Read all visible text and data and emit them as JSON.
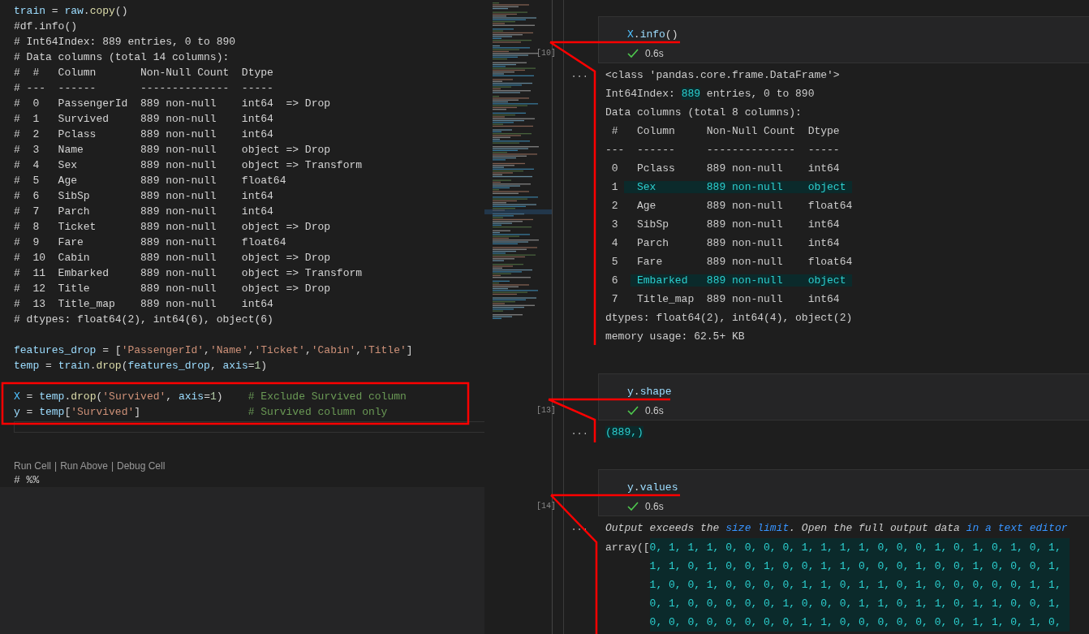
{
  "editor": {
    "lines": [
      {
        "kind": "code",
        "tokens": [
          {
            "kind": "variable",
            "text": "train"
          },
          {
            "kind": "plain",
            "text": " = "
          },
          {
            "kind": "variable",
            "text": "raw"
          },
          {
            "kind": "plain",
            "text": "."
          },
          {
            "kind": "function",
            "text": "copy"
          },
          {
            "kind": "plain",
            "text": "()"
          }
        ]
      },
      {
        "kind": "comment",
        "text": "#df.info()"
      },
      {
        "kind": "comment",
        "text": "# Int64Index: 889 entries, 0 to 890"
      },
      {
        "kind": "comment",
        "text": "# Data columns (total 14 columns):"
      },
      {
        "kind": "comment",
        "text": "#  #   Column       Non-Null Count  Dtype"
      },
      {
        "kind": "comment",
        "text": "# ---  ------       --------------  -----"
      },
      {
        "kind": "comment",
        "text": "#  0   PassengerId  889 non-null    int64  => Drop"
      },
      {
        "kind": "comment",
        "text": "#  1   Survived     889 non-null    int64"
      },
      {
        "kind": "comment",
        "text": "#  2   Pclass       889 non-null    int64"
      },
      {
        "kind": "comment",
        "text": "#  3   Name         889 non-null    object => Drop"
      },
      {
        "kind": "comment",
        "text": "#  4   Sex          889 non-null    object => Transform"
      },
      {
        "kind": "comment",
        "text": "#  5   Age          889 non-null    float64"
      },
      {
        "kind": "comment",
        "text": "#  6   SibSp        889 non-null    int64"
      },
      {
        "kind": "comment",
        "text": "#  7   Parch        889 non-null    int64"
      },
      {
        "kind": "comment",
        "text": "#  8   Ticket       889 non-null    object => Drop"
      },
      {
        "kind": "comment",
        "text": "#  9   Fare         889 non-null    float64"
      },
      {
        "kind": "comment",
        "text": "#  10  Cabin        889 non-null    object => Drop"
      },
      {
        "kind": "comment",
        "text": "#  11  Embarked     889 non-null    object => Transform"
      },
      {
        "kind": "comment",
        "text": "#  12  Title        889 non-null    object => Drop"
      },
      {
        "kind": "comment",
        "text": "#  13  Title_map    889 non-null    int64"
      },
      {
        "kind": "comment",
        "text": "# dtypes: float64(2), int64(6), object(6)"
      },
      {
        "kind": "blank"
      },
      {
        "kind": "code",
        "tokens": [
          {
            "kind": "variable",
            "text": "features_drop"
          },
          {
            "kind": "plain",
            "text": " = ["
          },
          {
            "kind": "string",
            "text": "'PassengerId'"
          },
          {
            "kind": "plain",
            "text": ","
          },
          {
            "kind": "string",
            "text": "'Name'"
          },
          {
            "kind": "plain",
            "text": ","
          },
          {
            "kind": "string",
            "text": "'Ticket'"
          },
          {
            "kind": "plain",
            "text": ","
          },
          {
            "kind": "string",
            "text": "'Cabin'"
          },
          {
            "kind": "plain",
            "text": ","
          },
          {
            "kind": "string",
            "text": "'Title'"
          },
          {
            "kind": "plain",
            "text": "]"
          }
        ]
      },
      {
        "kind": "code",
        "tokens": [
          {
            "kind": "variable",
            "text": "temp"
          },
          {
            "kind": "plain",
            "text": " = "
          },
          {
            "kind": "variable",
            "text": "train"
          },
          {
            "kind": "plain",
            "text": "."
          },
          {
            "kind": "function",
            "text": "drop"
          },
          {
            "kind": "plain",
            "text": "("
          },
          {
            "kind": "variable",
            "text": "features_drop"
          },
          {
            "kind": "plain",
            "text": ", "
          },
          {
            "kind": "variable",
            "text": "axis"
          },
          {
            "kind": "plain",
            "text": "="
          },
          {
            "kind": "number",
            "text": "1"
          },
          {
            "kind": "plain",
            "text": ")"
          }
        ]
      },
      {
        "kind": "blank"
      },
      {
        "kind": "code",
        "tokens": [
          {
            "kind": "constant",
            "text": "X"
          },
          {
            "kind": "plain",
            "text": " = "
          },
          {
            "kind": "variable",
            "text": "temp"
          },
          {
            "kind": "plain",
            "text": "."
          },
          {
            "kind": "function",
            "text": "drop"
          },
          {
            "kind": "plain",
            "text": "("
          },
          {
            "kind": "string",
            "text": "'Survived'"
          },
          {
            "kind": "plain",
            "text": ", "
          },
          {
            "kind": "variable",
            "text": "axis"
          },
          {
            "kind": "plain",
            "text": "="
          },
          {
            "kind": "number",
            "text": "1"
          },
          {
            "kind": "plain",
            "text": ")    "
          },
          {
            "kind": "comment",
            "text": "# Exclude Survived column"
          }
        ]
      },
      {
        "kind": "code",
        "tokens": [
          {
            "kind": "variable",
            "text": "y"
          },
          {
            "kind": "plain",
            "text": " = "
          },
          {
            "kind": "variable",
            "text": "temp"
          },
          {
            "kind": "plain",
            "text": "["
          },
          {
            "kind": "string",
            "text": "'Survived'"
          },
          {
            "kind": "plain",
            "text": "]                 "
          },
          {
            "kind": "comment",
            "text": "# Survived column only"
          }
        ]
      }
    ],
    "codelens": {
      "items": [
        "Run Cell",
        "Run Above",
        "Debug Cell"
      ],
      "separator": "|"
    },
    "next_cell_marker": "# %%"
  },
  "notebook": {
    "cells": [
      {
        "number": "[10]",
        "source": [
          {
            "kind": "constant",
            "text": "X"
          },
          {
            "kind": "plain",
            "text": "."
          },
          {
            "kind": "variable",
            "text": "info"
          },
          {
            "kind": "plain",
            "text": "()"
          }
        ],
        "succeeded": true,
        "duration": "0.6s",
        "output_marker": "...",
        "output": {
          "kind": "text",
          "lines": [
            [
              {
                "text": "<class 'pandas.core.frame.DataFrame'>",
                "highlighted": false
              }
            ],
            [
              {
                "text": "Int64Index: ",
                "highlighted": false
              },
              {
                "text": "889",
                "highlighted": true
              },
              {
                "text": " entries, 0 to 890",
                "highlighted": false
              }
            ],
            [
              {
                "text": "Data columns (total 8 columns):",
                "highlighted": false
              }
            ],
            [
              {
                "text": " #   Column     Non-Null Count  Dtype",
                "highlighted": false
              }
            ],
            [
              {
                "text": "---  ------     --------------  -----",
                "highlighted": false
              }
            ],
            [
              {
                "text": " 0   Pclass     889 non-null    int64",
                "highlighted": false
              }
            ],
            [
              {
                "text": " 1 ",
                "highlighted": false
              },
              {
                "text": "  Sex        889 non-null    object ",
                "highlighted": true
              }
            ],
            [
              {
                "text": " 2   Age        889 non-null    float64",
                "highlighted": false
              }
            ],
            [
              {
                "text": " 3   SibSp      889 non-null    int64",
                "highlighted": false
              }
            ],
            [
              {
                "text": " 4   Parch      889 non-null    int64",
                "highlighted": false
              }
            ],
            [
              {
                "text": " 5   Fare       889 non-null    float64",
                "highlighted": false
              }
            ],
            [
              {
                "text": " 6  ",
                "highlighted": false
              },
              {
                "text": " Embarked   889 non-null    object ",
                "highlighted": true
              }
            ],
            [
              {
                "text": " 7   Title_map  889 non-null    int64",
                "highlighted": false
              }
            ],
            [
              {
                "text": "dtypes: float64(2), int64(4), object(2)",
                "highlighted": false
              }
            ],
            [
              {
                "text": "memory usage: 62.5+ KB",
                "highlighted": false
              }
            ]
          ]
        }
      },
      {
        "number": "[13]",
        "source": [
          {
            "kind": "variable",
            "text": "y"
          },
          {
            "kind": "plain",
            "text": "."
          },
          {
            "kind": "variable",
            "text": "shape"
          }
        ],
        "succeeded": true,
        "duration": "0.6s",
        "output_marker": "...",
        "output": {
          "kind": "text",
          "lines": [
            [
              {
                "text": "(889,)",
                "highlighted": true
              }
            ]
          ]
        }
      },
      {
        "number": "[14]",
        "source": [
          {
            "kind": "variable",
            "text": "y"
          },
          {
            "kind": "plain",
            "text": "."
          },
          {
            "kind": "variable",
            "text": "values"
          }
        ],
        "succeeded": true,
        "duration": "0.6s",
        "output_marker": "...",
        "output": {
          "kind": "array",
          "notice": [
            {
              "text": "Output exceeds the ",
              "link": false
            },
            {
              "text": "size limit",
              "link": true
            },
            {
              "text": ". Open the full output data ",
              "link": false
            },
            {
              "text": "in a text editor",
              "link": true
            }
          ],
          "prefix": "array([",
          "rows": [
            "0, 1, 1, 1, 0, 0, 0, 0, 1, 1, 1, 1, 0, 0, 0, 1, 0, 1, 0, 1, 0, 1,",
            "1, 1, 0, 1, 0, 0, 1, 0, 0, 1, 1, 0, 0, 0, 1, 0, 0, 1, 0, 0, 0, 1,",
            "1, 0, 0, 1, 0, 0, 0, 0, 1, 1, 0, 1, 1, 0, 1, 0, 0, 0, 0, 0, 1, 1,",
            "0, 1, 0, 0, 0, 0, 0, 1, 0, 0, 0, 1, 1, 0, 1, 1, 0, 1, 1, 0, 0, 1,",
            "0, 0, 0, 0, 0, 0, 0, 0, 1, 1, 0, 0, 0, 0, 0, 0, 0, 1, 1, 0, 1, 0,"
          ]
        }
      }
    ]
  }
}
